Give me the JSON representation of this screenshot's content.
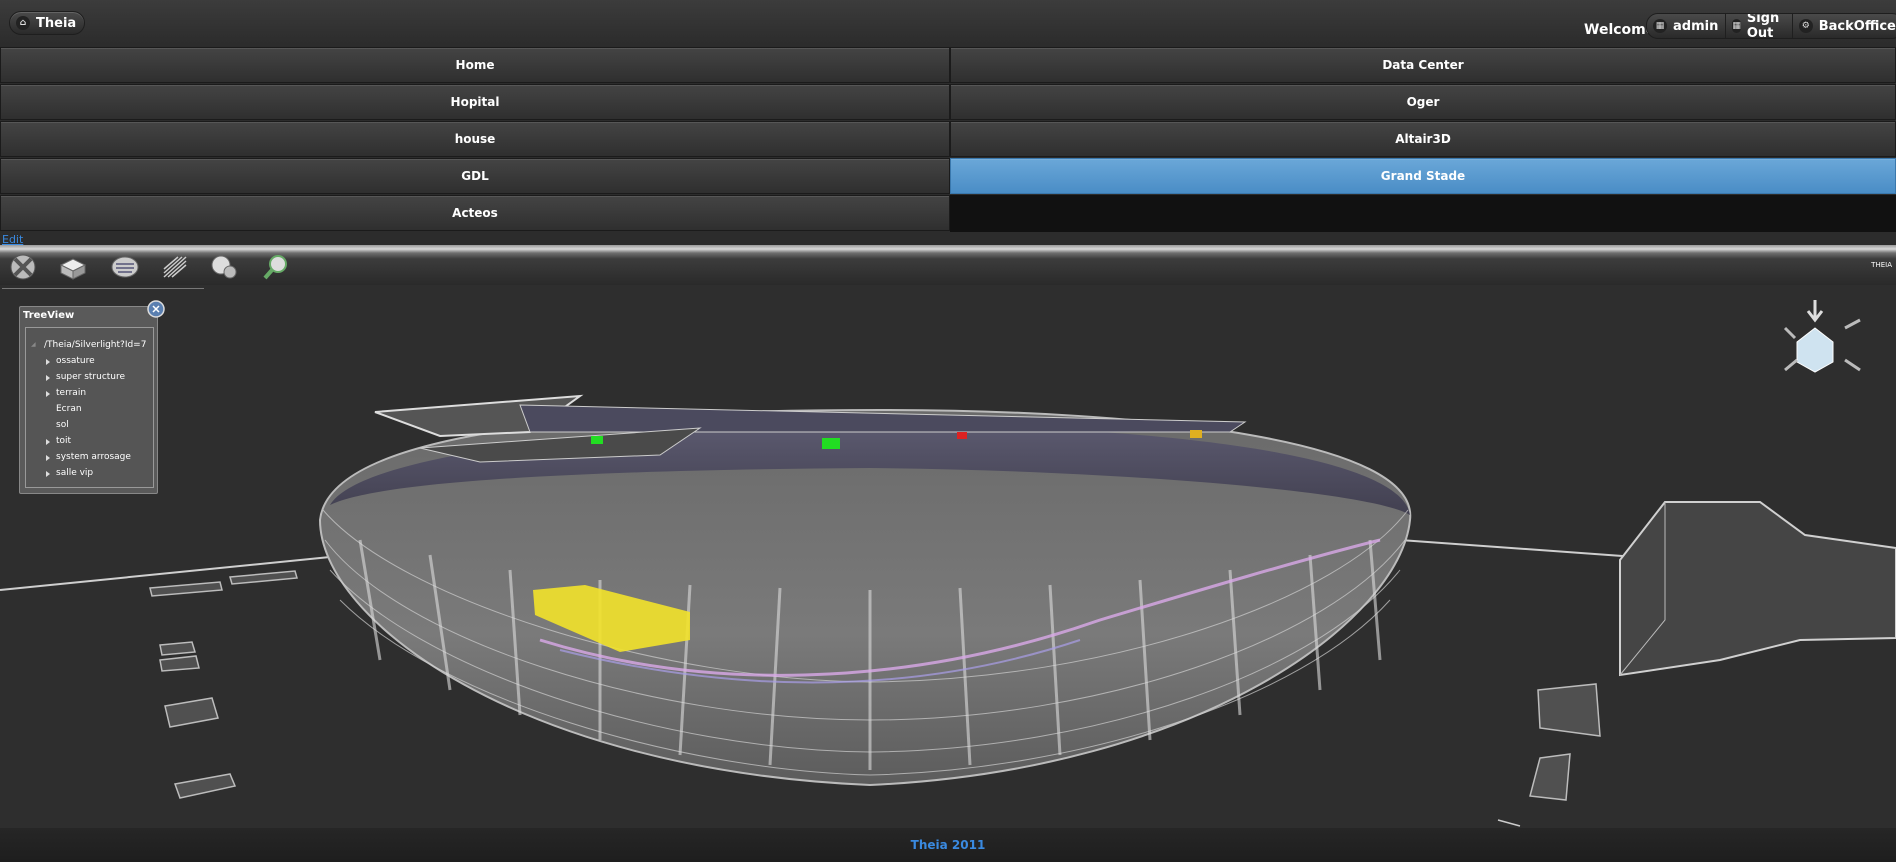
{
  "header": {
    "home_button_label": "Theia",
    "welcome_text": "Welcome,",
    "user_label": "admin",
    "signout_label": "Sign Out",
    "backoffice_label": "BackOffice"
  },
  "nav": {
    "items": [
      {
        "label": "Home"
      },
      {
        "label": "Data Center"
      },
      {
        "label": "Hopital"
      },
      {
        "label": "Oger"
      },
      {
        "label": "house"
      },
      {
        "label": "Altair3D"
      },
      {
        "label": "GDL"
      },
      {
        "label": "Grand Stade",
        "active": true
      },
      {
        "label": "Acteos"
      }
    ]
  },
  "edit_link": "Edit",
  "toolbar": {
    "right_label": "THEIA",
    "tools": [
      "tools-icon",
      "cube-icon",
      "layers-icon",
      "grid-icon",
      "globe-icon",
      "search-icon"
    ]
  },
  "treeview": {
    "title": "TreeView",
    "root": "/Theia/Silverlight?Id=7",
    "items": [
      {
        "label": "ossature",
        "expandable": true
      },
      {
        "label": "super structure",
        "expandable": true
      },
      {
        "label": "terrain",
        "expandable": true
      },
      {
        "label": "Ecran",
        "expandable": false
      },
      {
        "label": "sol",
        "expandable": false
      },
      {
        "label": "toit",
        "expandable": true
      },
      {
        "label": "system arrosage",
        "expandable": true
      },
      {
        "label": "salle vip",
        "expandable": true
      }
    ]
  },
  "footer": {
    "text": "Theia 2011"
  },
  "colors": {
    "accent": "#4a8dc6",
    "link": "#3a8ae0",
    "highlight_yellow": "#f2e22a",
    "marker_green": "#22dd22",
    "marker_red": "#dd2222"
  }
}
